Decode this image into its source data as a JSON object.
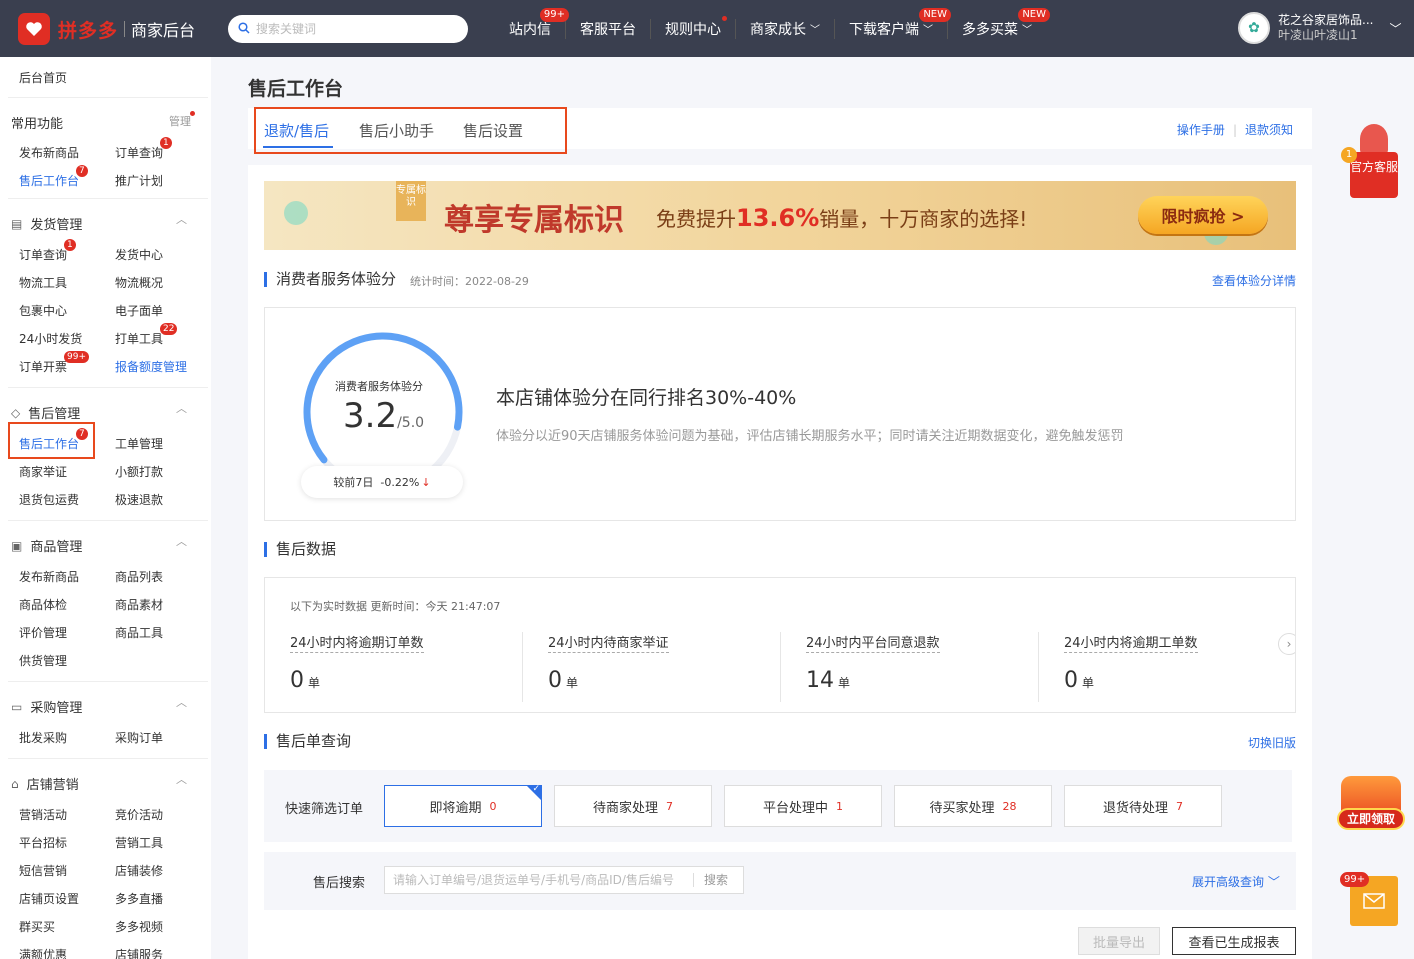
{
  "header": {
    "logo_text": "拼多多",
    "logo_sub": "商家后台",
    "search_placeholder": "搜索关键词",
    "nav": [
      {
        "label": "站内信",
        "badge": "99+"
      },
      {
        "label": "客服平台"
      },
      {
        "label": "规则中心"
      },
      {
        "label": "商家成长"
      },
      {
        "label": "下载客户端",
        "badge": "NEW"
      },
      {
        "label": "多多买菜",
        "badge": "NEW"
      }
    ],
    "user": {
      "name": "花之谷家居饰品...",
      "sub": "叶凌山叶凌山1"
    }
  },
  "sidebar": {
    "home": "后台首页",
    "common": {
      "title": "常用功能",
      "manage": "管理",
      "items": [
        {
          "label": "发布新商品"
        },
        {
          "label": "订单查询",
          "badge": "1"
        },
        {
          "label": "售后工作台",
          "badge": "7"
        },
        {
          "label": "推广计划"
        }
      ]
    },
    "shipping": {
      "title": "发货管理",
      "items": [
        {
          "label": "订单查询",
          "badge": "1"
        },
        {
          "label": "发货中心"
        },
        {
          "label": "物流工具"
        },
        {
          "label": "物流概况"
        },
        {
          "label": "包裹中心"
        },
        {
          "label": "电子面单"
        },
        {
          "label": "24小时发货"
        },
        {
          "label": "打单工具",
          "badge": "22"
        },
        {
          "label": "订单开票",
          "badge": "99+"
        },
        {
          "label": "报备额度管理"
        }
      ]
    },
    "aftersale": {
      "title": "售后管理",
      "items": [
        {
          "label": "售后工作台",
          "badge": "7"
        },
        {
          "label": "工单管理"
        },
        {
          "label": "商家举证"
        },
        {
          "label": "小额打款"
        },
        {
          "label": "退货包运费"
        },
        {
          "label": "极速退款"
        }
      ]
    },
    "goods": {
      "title": "商品管理",
      "items": [
        {
          "label": "发布新商品"
        },
        {
          "label": "商品列表"
        },
        {
          "label": "商品体检"
        },
        {
          "label": "商品素材"
        },
        {
          "label": "评价管理"
        },
        {
          "label": "商品工具"
        },
        {
          "label": "供货管理"
        }
      ]
    },
    "purchase": {
      "title": "采购管理",
      "items": [
        {
          "label": "批发采购"
        },
        {
          "label": "采购订单"
        }
      ]
    },
    "marketing": {
      "title": "店铺营销",
      "items": [
        {
          "label": "营销活动"
        },
        {
          "label": "竞价活动"
        },
        {
          "label": "平台招标"
        },
        {
          "label": "营销工具"
        },
        {
          "label": "短信营销"
        },
        {
          "label": "店铺装修"
        },
        {
          "label": "店铺页设置"
        },
        {
          "label": "多多直播"
        },
        {
          "label": "群买买"
        },
        {
          "label": "多多视频"
        },
        {
          "label": "满额优惠"
        },
        {
          "label": "店铺服务"
        }
      ]
    }
  },
  "page": {
    "title": "售后工作台",
    "tabs": [
      "退款/售后",
      "售后小助手",
      "售后设置"
    ],
    "tab_links": [
      "操作手册",
      "退款须知"
    ]
  },
  "banner": {
    "tag": "专属标识",
    "main": "尊享专属标识",
    "sub_prefix": "免费提升",
    "sub_highlight": "13.6%",
    "sub_suffix": "销量，十万商家的选择!",
    "button": "限时疯抢 >"
  },
  "score_section": {
    "title": "消费者服务体验分",
    "date": "统计时间：2022-08-29",
    "detail_link": "查看体验分详情",
    "gauge_label": "消费者服务体验分",
    "score": "3.2",
    "score_max": "/5.0",
    "score_fraction": 0.64,
    "compare": "较前7日",
    "compare_value": "-0.22%",
    "rank": "本店铺体验分在同行排名30%-40%",
    "desc": "体验分以近90天店铺服务体验问题为基础，评估店铺长期服务水平；同时请关注近期数据变化，避免触发惩罚"
  },
  "data_section": {
    "title": "售后数据",
    "note": "以下为实时数据 更新时间：今天 21:47:07",
    "metrics": [
      {
        "label": "24小时内将逾期订单数",
        "value": "0",
        "unit": "单"
      },
      {
        "label": "24小时内待商家举证",
        "value": "0",
        "unit": "单"
      },
      {
        "label": "24小时内平台同意退款",
        "value": "14",
        "unit": "单"
      },
      {
        "label": "24小时内将逾期工单数",
        "value": "0",
        "unit": "单"
      }
    ]
  },
  "query_section": {
    "title": "售后单查询",
    "switch_link": "切换旧版",
    "filter_label": "快速筛选订单",
    "filters": [
      {
        "label": "即将逾期",
        "count": "0"
      },
      {
        "label": "待商家处理",
        "count": "7"
      },
      {
        "label": "平台处理中",
        "count": "1"
      },
      {
        "label": "待买家处理",
        "count": "28"
      },
      {
        "label": "退货待处理",
        "count": "7"
      }
    ],
    "search_label": "售后搜索",
    "search_placeholder": "请输入订单编号/退货运单号/手机号/商品ID/售后编号",
    "search_button": "搜索",
    "advanced": "展开高级查询",
    "export": "批量导出",
    "report": "查看已生成报表"
  },
  "floats": {
    "cs": "官方客服",
    "cs_badge": "1",
    "gift": "立即领取",
    "mail_badge": "99+"
  },
  "colors": {
    "brand": "#e02e24",
    "accent": "#2d6fe5",
    "topbar": "#3a3f4f"
  }
}
